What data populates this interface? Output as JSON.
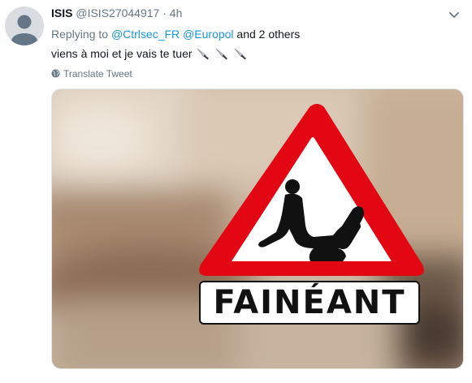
{
  "tweet": {
    "author_name": "ISIS",
    "author_handle": "@ISIS27044917",
    "separator": "·",
    "time": "4h",
    "reply_prefix": "Replying to",
    "reply_mentions": [
      "@Ctrlsec_FR",
      "@Europol"
    ],
    "reply_suffix": "and 2 others",
    "text": "viens à moi et je vais te tuer",
    "emoji_count": 3,
    "emoji_icon": "knife-icon",
    "translate_label": "Translate Tweet"
  },
  "media": {
    "sign_caption": "FAINÉANT",
    "sign_icon": "warning-triangle-lounging-person",
    "colors": {
      "sign_red": "#e30613",
      "sign_white": "#ffffff",
      "figure": "#111111"
    }
  },
  "colors": {
    "link": "#1b95e0",
    "secondary": "#657786"
  }
}
